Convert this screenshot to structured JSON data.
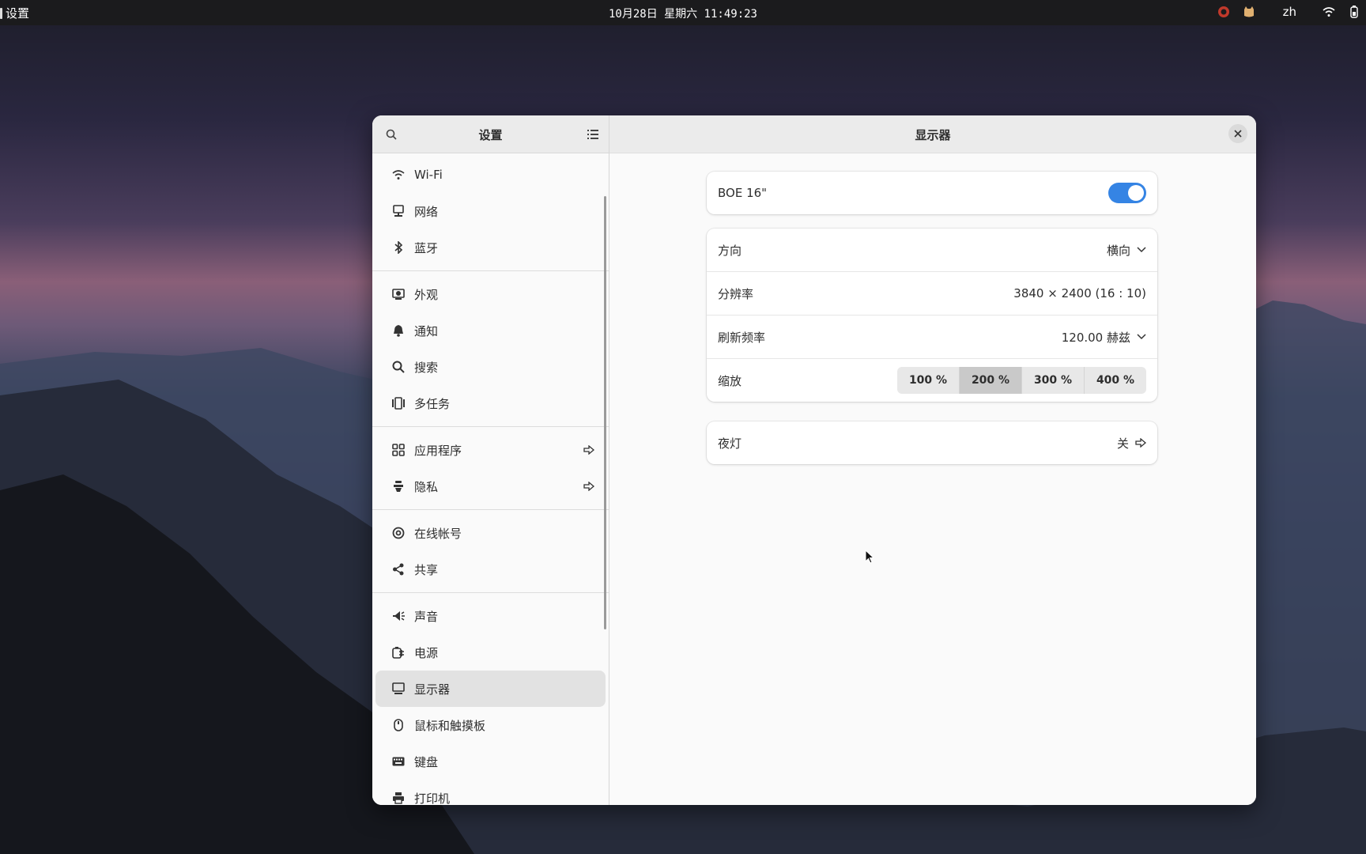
{
  "topbar": {
    "app_name": "设置",
    "clock": "10月28日 星期六 11:49:23",
    "lang": "zh"
  },
  "sidebar": {
    "title": "设置",
    "groups": [
      [
        {
          "label": "Wi-Fi",
          "icon": "wifi-icon"
        },
        {
          "label": "网络",
          "icon": "network-icon"
        },
        {
          "label": "蓝牙",
          "icon": "bluetooth-icon"
        }
      ],
      [
        {
          "label": "外观",
          "icon": "appearance-icon"
        },
        {
          "label": "通知",
          "icon": "bell-icon"
        },
        {
          "label": "搜索",
          "icon": "search-icon"
        },
        {
          "label": "多任务",
          "icon": "multitasking-icon"
        }
      ],
      [
        {
          "label": "应用程序",
          "icon": "apps-icon"
        },
        {
          "label": "隐私",
          "icon": "privacy-icon"
        }
      ],
      [
        {
          "label": "在线帐号",
          "icon": "at-icon"
        },
        {
          "label": "共享",
          "icon": "share-icon"
        }
      ],
      [
        {
          "label": "声音",
          "icon": "sound-icon"
        },
        {
          "label": "电源",
          "icon": "power-icon"
        },
        {
          "label": "显示器",
          "icon": "display-icon"
        },
        {
          "label": "鼠标和触摸板",
          "icon": "mouse-icon"
        },
        {
          "label": "键盘",
          "icon": "keyboard-icon"
        },
        {
          "label": "打印机",
          "icon": "printer-icon"
        }
      ]
    ]
  },
  "main": {
    "title": "显示器",
    "monitor": {
      "name": "BOE 16\"",
      "enabled": true
    },
    "orientation": {
      "label": "方向",
      "value": "横向"
    },
    "resolution": {
      "label": "分辨率",
      "value": "3840 × 2400 (16 : 10)"
    },
    "refresh": {
      "label": "刷新频率",
      "value": "120.00 赫兹"
    },
    "scale": {
      "label": "缩放",
      "options": [
        "100 %",
        "200 %",
        "300 %",
        "400 %"
      ],
      "selected": "200 %"
    },
    "night_light": {
      "label": "夜灯",
      "value": "关"
    }
  },
  "colors": {
    "accent": "#3584e4",
    "topbar": "#1b1b1d"
  }
}
